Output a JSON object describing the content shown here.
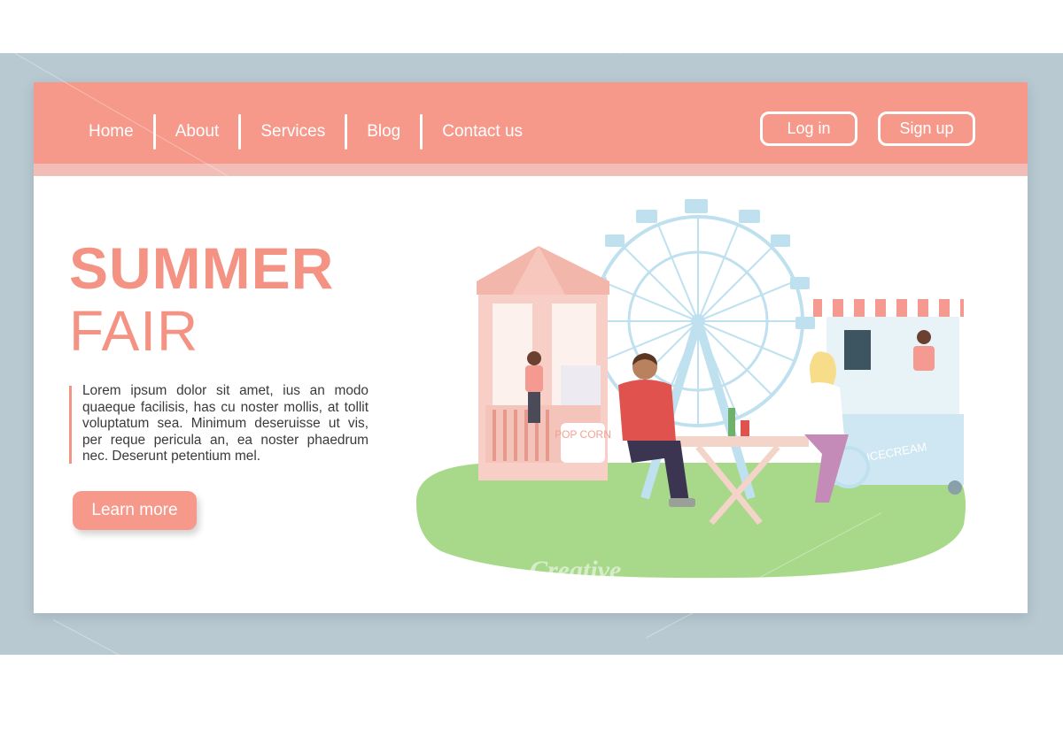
{
  "nav": {
    "items": [
      {
        "label": "Home"
      },
      {
        "label": "About"
      },
      {
        "label": "Services"
      },
      {
        "label": "Blog"
      },
      {
        "label": "Contact us"
      }
    ],
    "login_label": "Log in",
    "signup_label": "Sign up"
  },
  "hero": {
    "title_line1": "SUMMER",
    "title_line2": "FAIR",
    "body": "Lorem ipsum dolor sit amet, ius an modo quaeque facilisis, has cu noster mollis, at tollit voluptatum sea. Minimum deseruisse ut vis, per reque pericula an, ea noster phaedrum nec. Deserunt petentium mel.",
    "cta_label": "Learn more"
  },
  "illustration": {
    "popcorn_sign": "POP CORN",
    "icecream_sign": "ICECREAM"
  },
  "colors": {
    "accent": "#f6998b",
    "backdrop": "#b8c9d2",
    "grass": "#a8d98a",
    "ferris": "#bfe1ef"
  }
}
